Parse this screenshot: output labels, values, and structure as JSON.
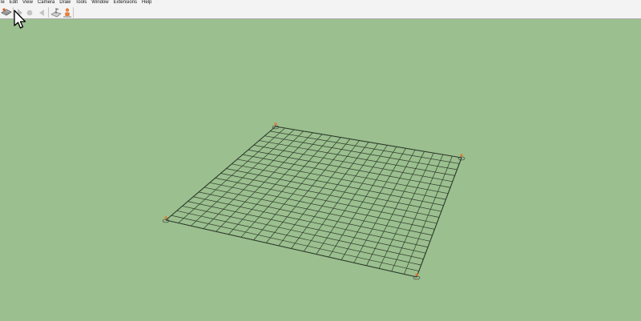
{
  "menu": [
    "le",
    "Edit",
    "View",
    "Camera",
    "Draw",
    "Tools",
    "Window",
    "Extensions",
    "Help"
  ],
  "toolbar": {
    "tools": [
      {
        "name": "tool-icon-1",
        "icon": "sandbox-tool-icon"
      },
      {
        "name": "tool-icon-2",
        "icon": "stop-record-icon"
      },
      {
        "name": "tool-icon-3",
        "icon": "play-back-icon"
      },
      {
        "name": "tool-icon-4",
        "icon": "map-pin-tool-icon"
      },
      {
        "name": "tool-icon-5",
        "icon": "person-tool-icon"
      }
    ]
  },
  "viewport": {
    "background": "#9bbf8f",
    "grid": {
      "rows": 20,
      "cols": 20,
      "color": "#2c3a2a"
    },
    "corner_marker_color": "#e07a2c"
  }
}
